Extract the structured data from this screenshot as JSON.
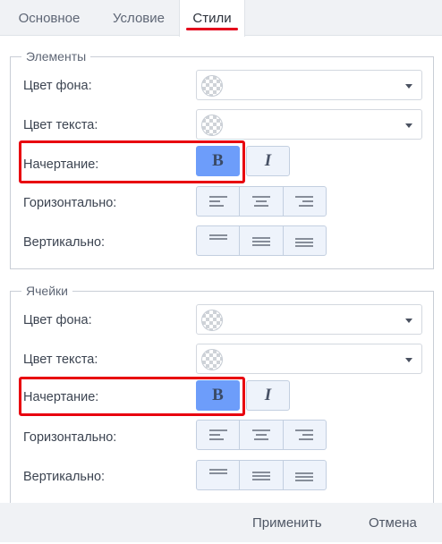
{
  "tabs": [
    {
      "label": "Основное",
      "active": false
    },
    {
      "label": "Условие",
      "active": false
    },
    {
      "label": "Стили",
      "active": true
    }
  ],
  "elements_group": {
    "legend": "Элементы",
    "bg_color_label": "Цвет фона:",
    "text_color_label": "Цвет текста:",
    "font_style_label": "Начертание:",
    "horizontal_label": "Горизонтально:",
    "vertical_label": "Вертикально:",
    "bold_label": "B",
    "italic_label": "I",
    "bold_active": true
  },
  "cells_group": {
    "legend": "Ячейки",
    "bg_color_label": "Цвет фона:",
    "text_color_label": "Цвет текста:",
    "font_style_label": "Начертание:",
    "horizontal_label": "Горизонтально:",
    "vertical_label": "Вертикально:",
    "bold_label": "B",
    "italic_label": "I",
    "bold_active": true
  },
  "footer": {
    "apply_label": "Применить",
    "cancel_label": "Отмена"
  },
  "colors": {
    "accent_active": "#6d9dfa",
    "highlight": "#e8000f",
    "tab_underline": "#e4001b"
  },
  "icons": {
    "swatch": "transparent-swatch-icon",
    "dropdown": "chevron-down-icon",
    "align_left": "align-left-icon",
    "align_center": "align-center-icon",
    "align_right": "align-right-icon",
    "valign_top": "align-top-icon",
    "valign_middle": "align-middle-icon",
    "valign_bottom": "align-bottom-icon"
  }
}
